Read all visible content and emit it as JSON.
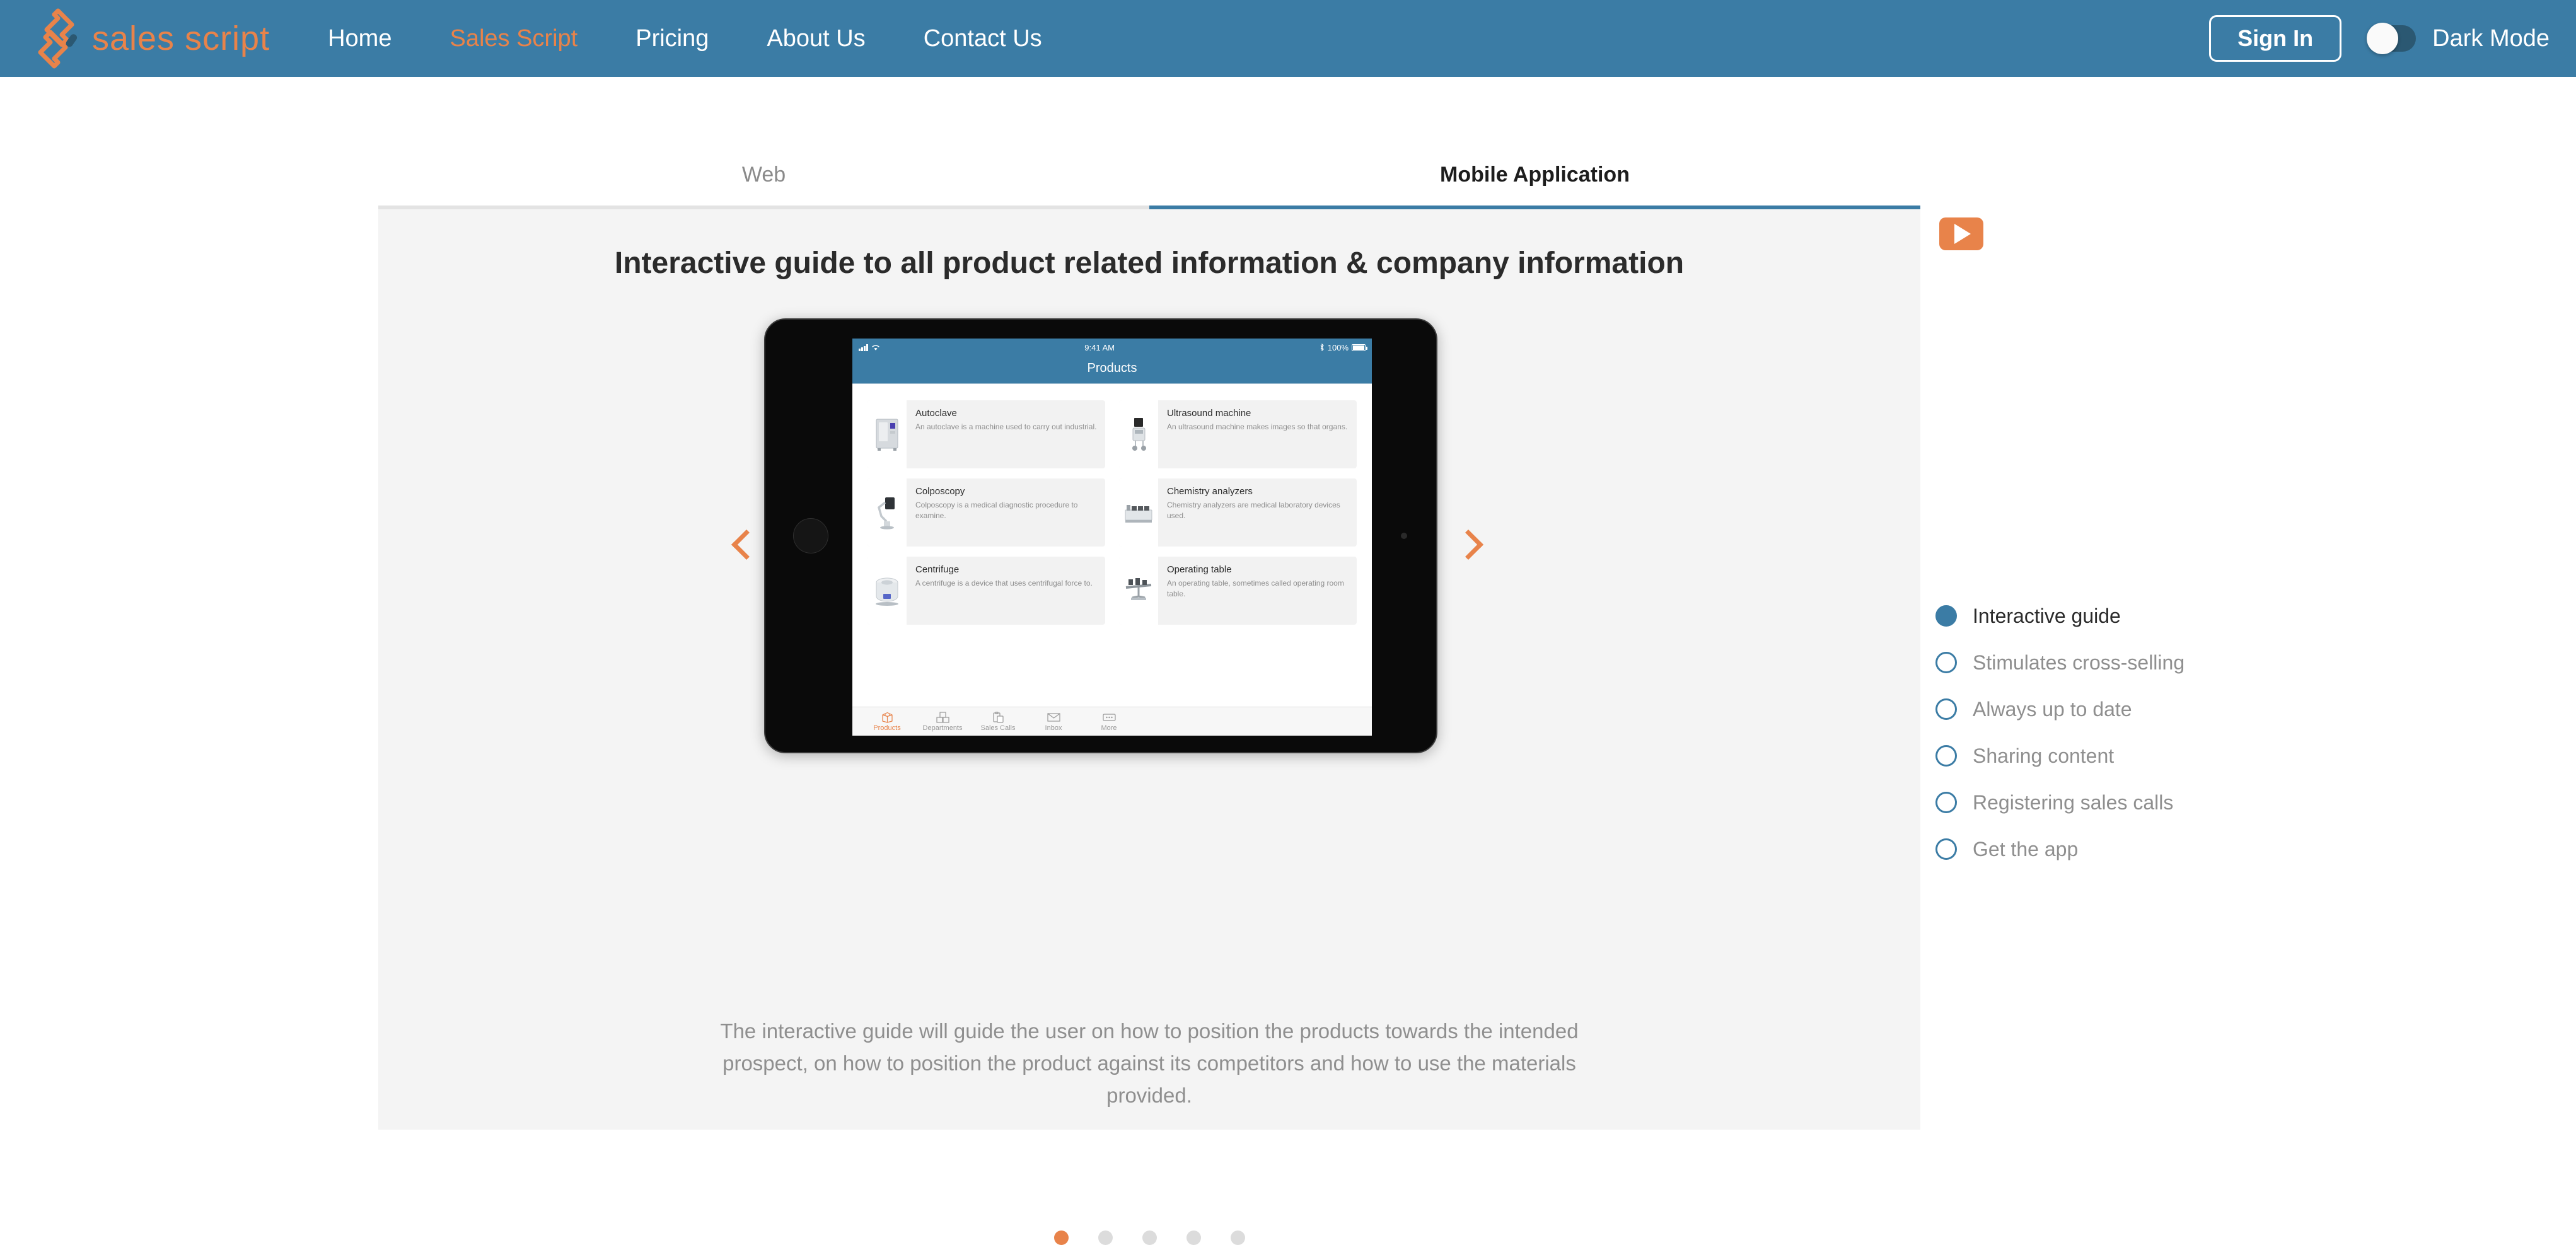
{
  "nav": {
    "brand": {
      "name": "sales script",
      "logo_icon": "sales-script-s-logo"
    },
    "links": [
      {
        "label": "Home",
        "active": false
      },
      {
        "label": "Sales Script",
        "active": true
      },
      {
        "label": "Pricing",
        "active": false
      },
      {
        "label": "About Us",
        "active": false
      },
      {
        "label": "Contact Us",
        "active": false
      }
    ],
    "sign_in": "Sign In",
    "dark_mode_label": "Dark Mode",
    "dark_mode_on": false
  },
  "tabs": [
    {
      "label": "Web",
      "active": false
    },
    {
      "label": "Mobile Application",
      "active": true
    }
  ],
  "panel": {
    "heading": "Interactive guide to all product related information & company information",
    "description": "The interactive guide will guide the user on how to position the products towards the intended prospect, on how to position the product against its competitors and how to use the materials provided.",
    "play_button_icon": "play-icon",
    "prev_arrow_icon": "chevron-left-icon",
    "next_arrow_icon": "chevron-right-icon",
    "dots": [
      {
        "active": true
      },
      {
        "active": false
      },
      {
        "active": false
      },
      {
        "active": false
      },
      {
        "active": false
      }
    ]
  },
  "device": {
    "status_bar": {
      "time": "9:41 AM",
      "battery": "100%"
    },
    "screen_title": "Products",
    "products": [
      {
        "name": "Autoclave",
        "desc": "An autoclave is a machine used to carry out industrial."
      },
      {
        "name": "Ultrasound machine",
        "desc": "An ultrasound machine makes images so that organs."
      },
      {
        "name": "Colposcopy",
        "desc": "Colposcopy is a medical diagnostic procedure to examine."
      },
      {
        "name": "Chemistry analyzers",
        "desc": "Chemistry analyzers are medical laboratory devices used."
      },
      {
        "name": "Centrifuge",
        "desc": "A centrifuge is a device that uses centrifugal force to."
      },
      {
        "name": "Operating table",
        "desc": "An operating table, sometimes called operating room table."
      }
    ],
    "tabbar": [
      {
        "label": "Products",
        "icon": "box-icon",
        "active": true
      },
      {
        "label": "Departments",
        "icon": "boxes-icon",
        "active": false
      },
      {
        "label": "Sales Calls",
        "icon": "clipboard-icon",
        "active": false
      },
      {
        "label": "Inbox",
        "icon": "envelope-icon",
        "active": false
      },
      {
        "label": "More",
        "icon": "ellipsis-icon",
        "active": false
      }
    ]
  },
  "steps": [
    {
      "label": "Interactive guide",
      "active": true
    },
    {
      "label": "Stimulates cross-selling",
      "active": false
    },
    {
      "label": "Always up to date",
      "active": false
    },
    {
      "label": "Sharing content",
      "active": false
    },
    {
      "label": "Registering sales calls",
      "active": false
    },
    {
      "label": "Get the app",
      "active": false
    }
  ],
  "colors": {
    "brand_blue": "#3b7ca5",
    "brand_orange": "#e8834a",
    "panel_bg": "#f4f4f4",
    "muted_text": "#8f8f8f"
  }
}
